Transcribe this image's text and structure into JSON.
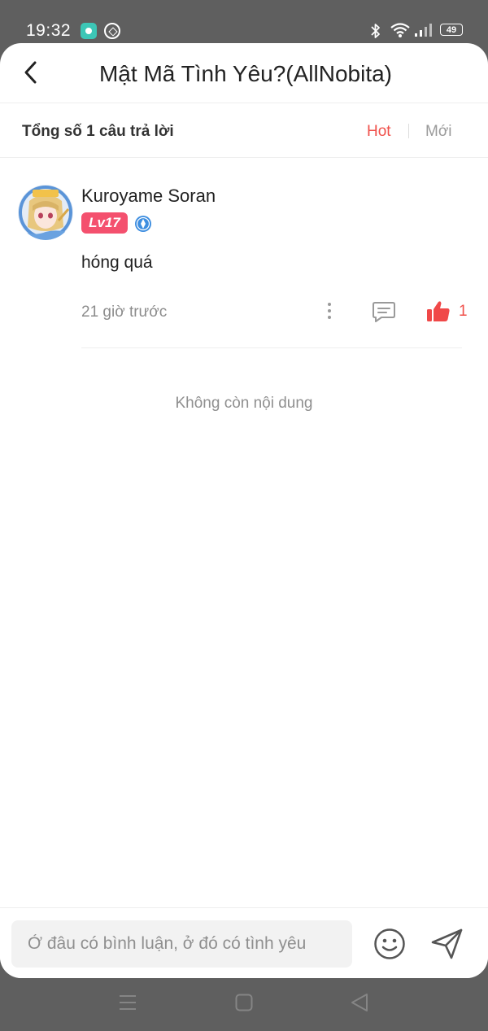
{
  "status_bar": {
    "time": "19:32",
    "battery": "49",
    "icons": [
      "app-notification-icon",
      "compass-icon",
      "bluetooth-icon",
      "wifi-icon",
      "signal-icon",
      "battery-icon"
    ]
  },
  "header": {
    "back_icon": "chevron-left-icon",
    "title": "Mật Mã Tình Yêu?(AllNobita)"
  },
  "answers_bar": {
    "count_label": "Tổng số 1 câu trả lời",
    "sort_options": [
      {
        "label": "Hot",
        "active": true
      },
      {
        "label": "Mới",
        "active": false
      }
    ]
  },
  "comments": [
    {
      "username": "Kuroyame Soran",
      "level": "Lv17",
      "text": "hóng quá",
      "time": "21 giờ trước",
      "likes": "1",
      "liked": true
    }
  ],
  "end_message": "Không còn nội dung",
  "composer": {
    "placeholder": "Ở đâu có bình luận, ở đó có tình yêu",
    "value": ""
  },
  "colors": {
    "accent": "#f0504a",
    "level_badge": "#f4506e",
    "author_badge": "#3e8ee0",
    "sheet_background": "#ffffff",
    "screen_background": "#5f5f5f"
  }
}
